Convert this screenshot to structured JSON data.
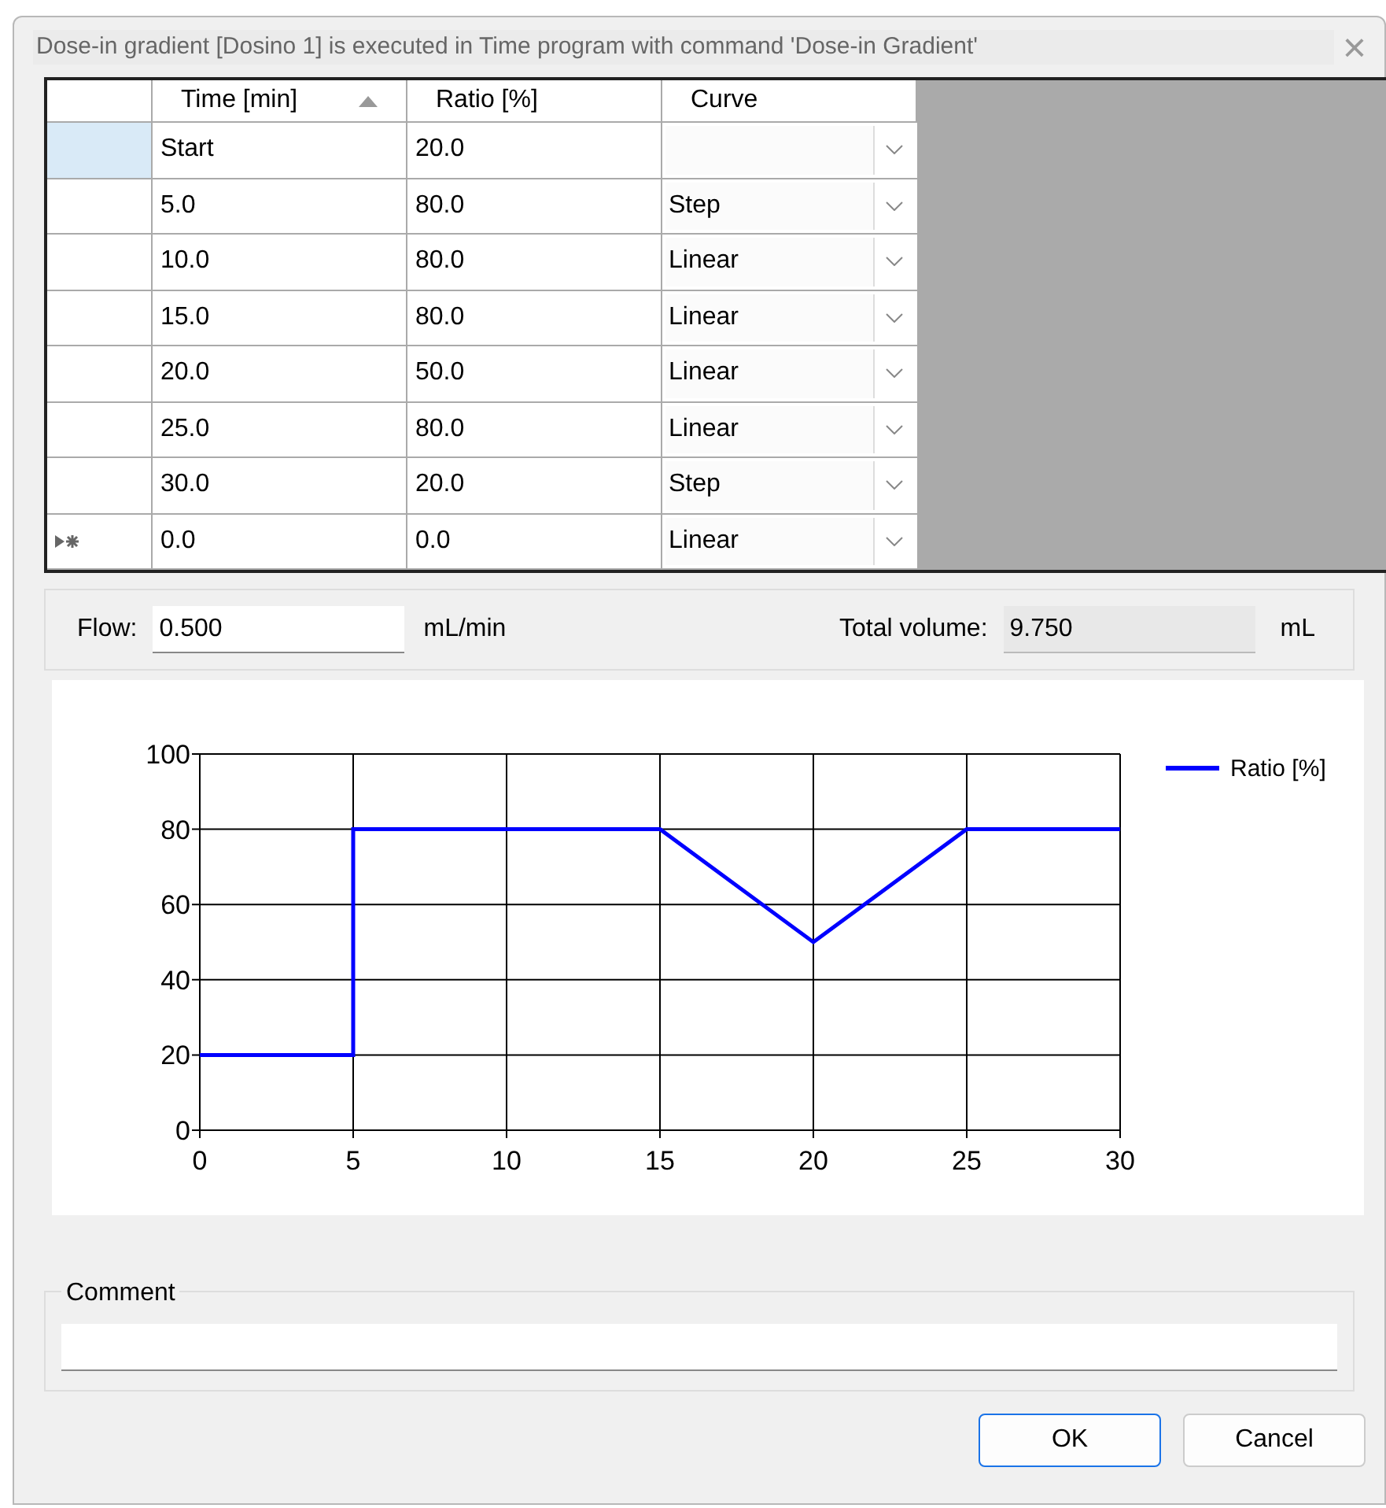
{
  "window": {
    "title": "Dose-in gradient [Dosino 1] is executed in Time program with command 'Dose-in Gradient'",
    "close": "×"
  },
  "table": {
    "columns": [
      {
        "label": "Time [min]",
        "sorted": true
      },
      {
        "label": "Ratio [%]",
        "sorted": false
      },
      {
        "label": "Curve",
        "sorted": false
      }
    ],
    "rows": [
      {
        "time": "Start",
        "ratio": "20.0",
        "selected": true,
        "new_row": false
      },
      {
        "time": "5.0",
        "ratio": "80.0",
        "curve": "Step",
        "selected": false,
        "new_row": false
      },
      {
        "time": "10.0",
        "ratio": "80.0",
        "curve": "Linear",
        "selected": false,
        "new_row": false
      },
      {
        "time": "15.0",
        "ratio": "80.0",
        "curve": "Linear",
        "selected": false,
        "new_row": false
      },
      {
        "time": "20.0",
        "ratio": "50.0",
        "curve": "Linear",
        "selected": false,
        "new_row": false
      },
      {
        "time": "25.0",
        "ratio": "80.0",
        "curve": "Linear",
        "selected": false,
        "new_row": false
      },
      {
        "time": "30.0",
        "ratio": "20.0",
        "curve": "Step",
        "selected": false,
        "new_row": false
      },
      {
        "time": "0.0",
        "ratio": "0.0",
        "curve": "Linear",
        "selected": false,
        "new_row": true
      }
    ]
  },
  "flow": {
    "label": "Flow:",
    "value": "0.500",
    "unit": "mL/min"
  },
  "total_volume": {
    "label": "Total volume:",
    "value": "9.750",
    "unit": "mL"
  },
  "chart": {
    "chart_data": {
      "type": "line",
      "grid": true,
      "x": [
        0,
        5,
        5,
        15,
        20,
        25,
        30
      ],
      "series": [
        {
          "name": "Ratio [%]",
          "color": "#0000ff",
          "values": [
            20,
            20,
            80,
            80,
            50,
            80,
            80
          ]
        }
      ],
      "xlim": [
        0,
        30
      ],
      "ylim": [
        0,
        100
      ],
      "xticks": [
        0,
        5,
        10,
        15,
        20,
        25,
        30
      ],
      "yticks": [
        0,
        20,
        40,
        60,
        80,
        100
      ]
    }
  },
  "comment": {
    "label": "Comment"
  },
  "buttons": [
    {
      "label": "OK",
      "default": true
    },
    {
      "label": "Cancel",
      "default": false
    }
  ]
}
